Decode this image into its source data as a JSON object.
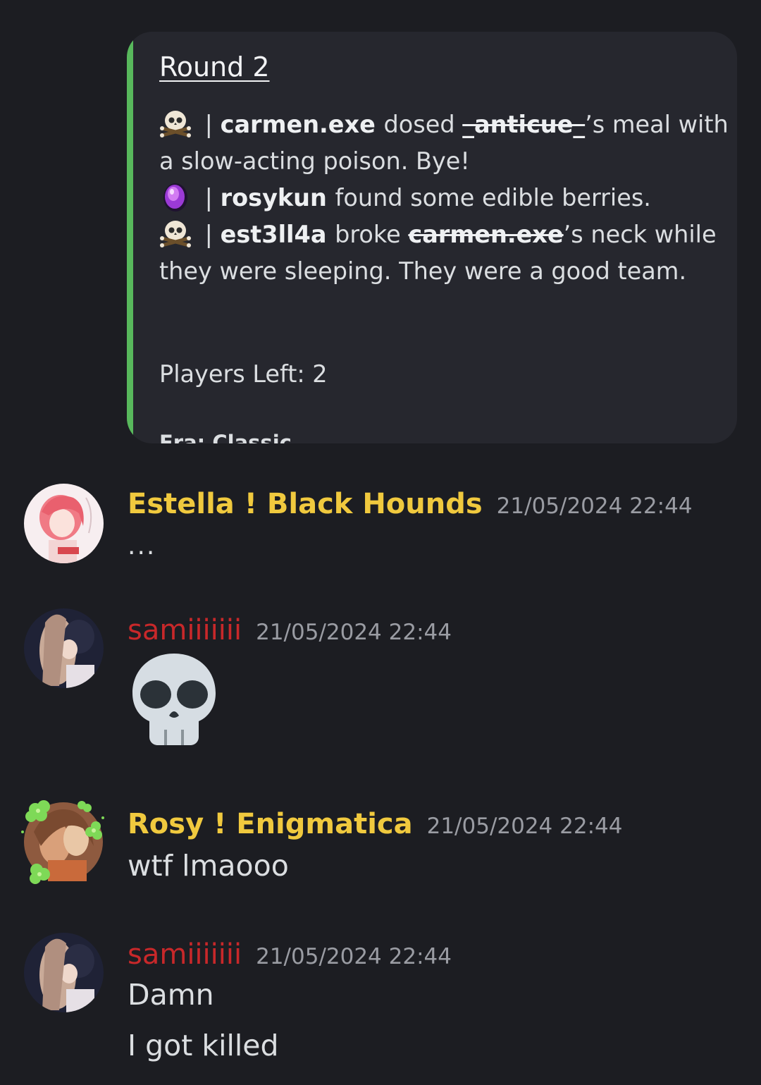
{
  "embed": {
    "accent_color": "#58b85c",
    "title": "Round 2",
    "lines": [
      {
        "icon": "skull-crossbones-icon",
        "pipe": "|",
        "actor": "carmen.exe",
        "text_before": "dosed",
        "victim": "_anticue_",
        "text_after": "’s meal with"
      },
      {
        "continuation": "a slow-acting poison. Bye!"
      },
      {
        "icon": "purple-berry-icon",
        "pipe": "|",
        "actor": "rosykun",
        "text_after": "found some edible berries."
      },
      {
        "icon": "skull-crossbones-icon",
        "pipe": "|",
        "actor": "est3ll4a",
        "text_before": "broke",
        "victim": "carmen.exe",
        "text_after": "’s neck while"
      },
      {
        "continuation": "they were sleeping. They were a good team."
      }
    ],
    "players_left": "Players Left: 2",
    "footer": "Era: Classic"
  },
  "messages": [
    {
      "username": "Estella ! Black Hounds",
      "username_color": "#f0c93e",
      "timestamp": "21/05/2024 22:44",
      "text": "..."
    },
    {
      "username": "samiiiiiii",
      "username_color": "#c8282a",
      "timestamp": "21/05/2024 22:44",
      "emoji": "skull-icon"
    },
    {
      "username": "Rosy ! Enigmatica",
      "username_color": "#f0c93e",
      "timestamp": "21/05/2024 22:44",
      "text": "wtf lmaooo"
    },
    {
      "username": "samiiiiiii",
      "username_color": "#c8282a",
      "timestamp": "21/05/2024 22:44",
      "text": "Damn",
      "text2": "I got killed"
    }
  ]
}
